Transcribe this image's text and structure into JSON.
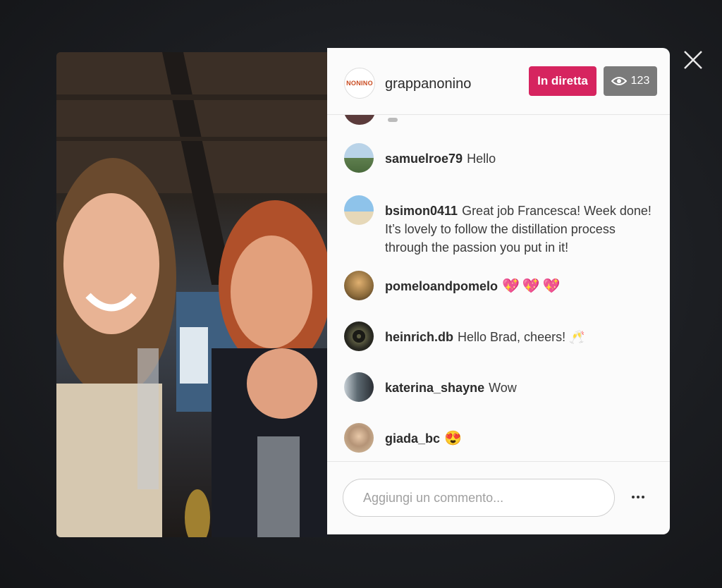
{
  "host": {
    "avatar_text": "NONINO",
    "username": "grappanonino"
  },
  "status": {
    "live_label": "In diretta",
    "viewer_count": "123"
  },
  "comments": [
    {
      "user": "samuelroe79",
      "text": "Hello",
      "avatar_color": "#6f8a6a"
    },
    {
      "user": "bsimon0411",
      "text": "Great job Francesca! Week done! It’s lovely to follow the distillation process through the passion you put in it!",
      "avatar_color": "#4f86b8"
    },
    {
      "user": "pomeloandpomelo",
      "text": "💖💖💖",
      "avatar_color": "#8b6a3a"
    },
    {
      "user": "heinrich.db",
      "text": "Hello Brad, cheers! 🥂",
      "avatar_color": "#3a3a32"
    },
    {
      "user": "katerina_shayne",
      "text": "Wow",
      "avatar_color": "#5d6a72"
    },
    {
      "user": "giada_bc",
      "text": "😍",
      "avatar_color": "#b59477"
    }
  ],
  "footer": {
    "comment_placeholder": "Aggiungi un commento..."
  },
  "colors": {
    "live_badge": "#d6245f",
    "viewer_badge": "#7a7a7a"
  }
}
